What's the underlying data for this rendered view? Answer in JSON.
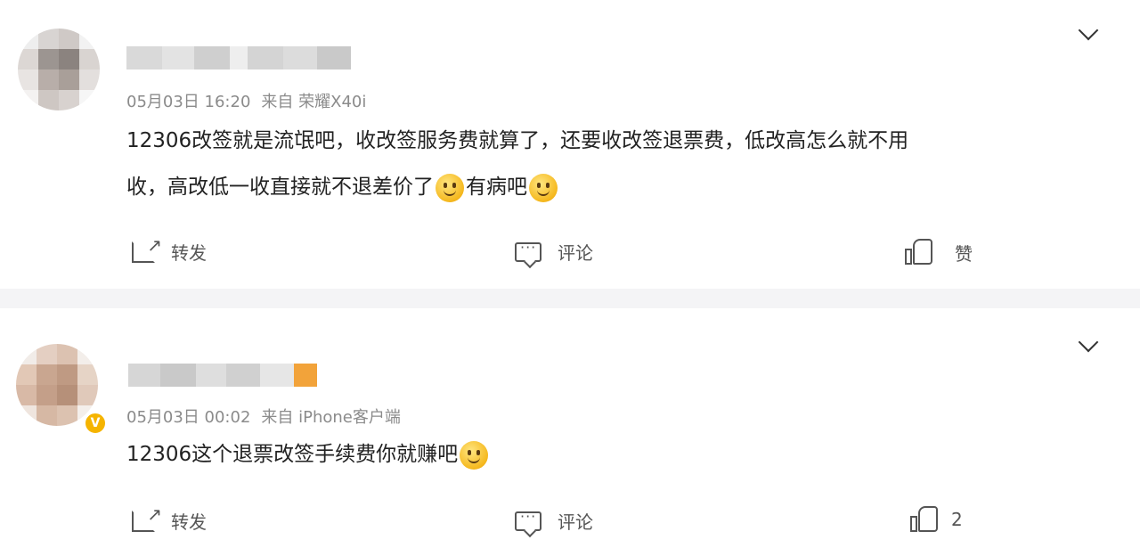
{
  "posts": [
    {
      "time": "05月03日 16:20",
      "source": "来自 荣耀X40i",
      "content_line1": "12306改签就是流氓吧，收改签服务费就算了，还要收改签退票费，低改高怎么就不用",
      "content_line2a": "收，高改低一收直接就不退差价了",
      "content_line2b": "有病吧",
      "emoji_names": [
        "smile-emoji",
        "shy-smile-emoji"
      ],
      "actions": {
        "repost": "转发",
        "comment": "评论",
        "like": "赞"
      }
    },
    {
      "time": "05月03日 00:02",
      "source": "来自 iPhone客户端",
      "content": "12306这个退票改签手续费你就赚吧",
      "emoji_names": [
        "drool-emoji"
      ],
      "verified": true,
      "actions": {
        "repost": "转发",
        "comment": "评论",
        "like": "2"
      }
    }
  ],
  "colors": {
    "meta": "#8b8b8b",
    "text": "#222222",
    "badge": "#f5b400",
    "separator": "#f4f4f6"
  },
  "icons": [
    "chevron-down-icon",
    "repost-icon",
    "comment-icon",
    "like-icon"
  ]
}
